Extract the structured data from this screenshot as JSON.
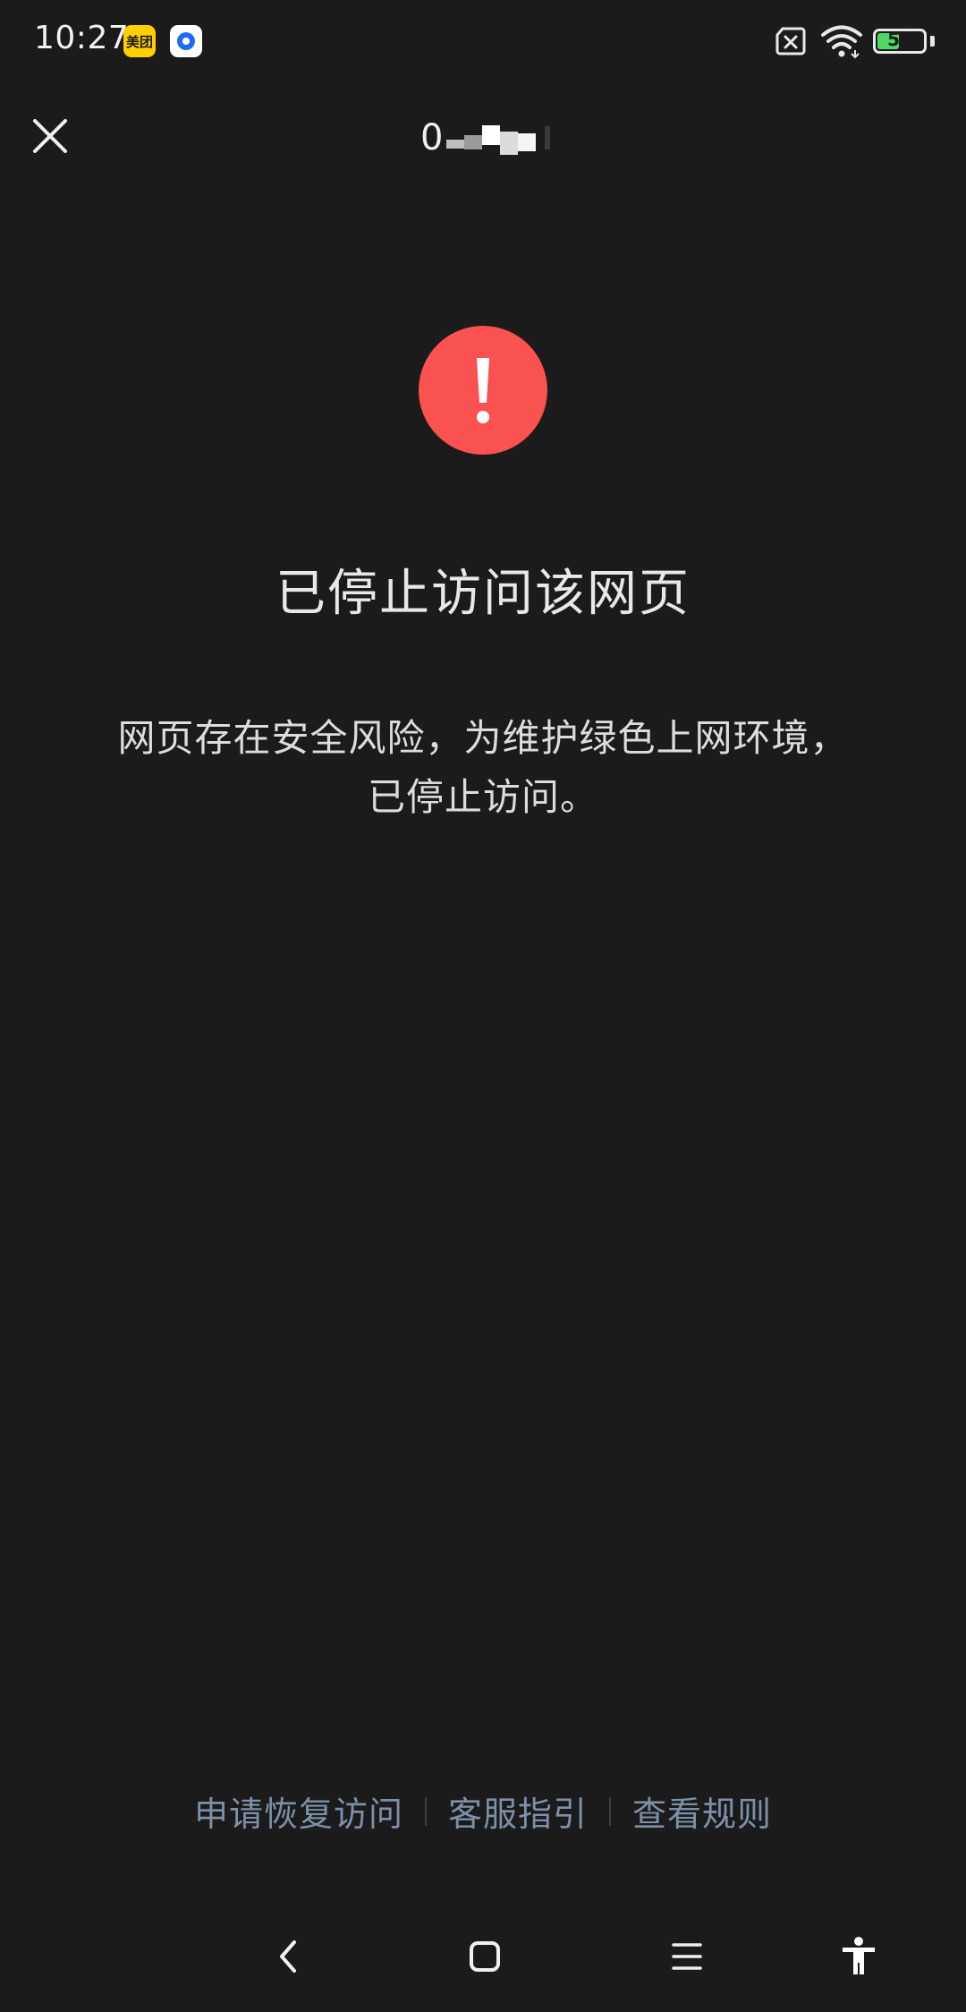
{
  "status_bar": {
    "time": "10:27",
    "notification_app_1_label": "美团",
    "notification_app_1_color": "#ffd000",
    "notification_app_2_color": "#1e6cf0",
    "battery_level": "52",
    "battery_fraction": 0.52,
    "battery_color": "#4cd964"
  },
  "header": {
    "title_visible": "0",
    "close_icon": "close-icon"
  },
  "warning": {
    "icon_color": "#fa5151",
    "icon_glyph": "!",
    "title": "已停止访问该网页",
    "description_line1": "网页存在安全风险，为维护绿色上网环境，",
    "description_line2": "已停止访问。"
  },
  "footer": {
    "link_color": "#7d90a9",
    "links": [
      {
        "label": "申请恢复访问"
      },
      {
        "label": "客服指引"
      },
      {
        "label": "查看规则"
      }
    ]
  },
  "nav_bar": {
    "icons": [
      "back-icon",
      "home-icon",
      "menu-icon",
      "accessibility-icon"
    ]
  }
}
